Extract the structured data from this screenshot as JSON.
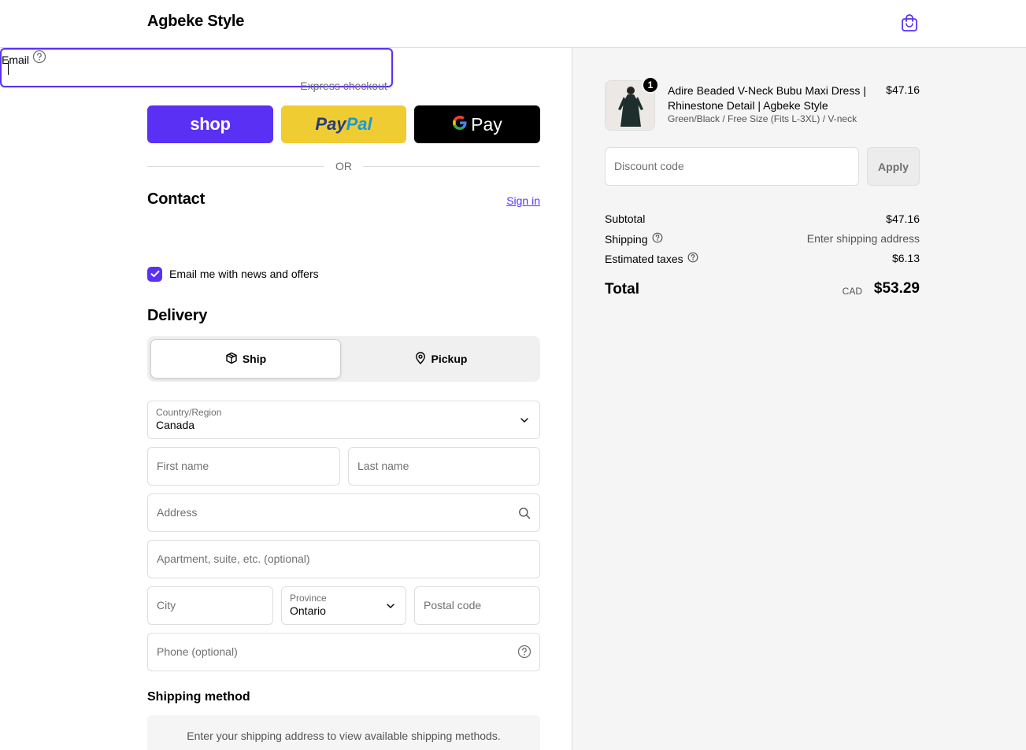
{
  "header": {
    "brand": "Agbeke Style",
    "cart_icon": "shopping-bag-icon"
  },
  "colors": {
    "accent": "#5a31f4",
    "shop_pay": "#5a31f4",
    "paypal": "#f0cc33",
    "gpay": "#000000",
    "summary_bg": "#f5f5f5"
  },
  "express": {
    "label": "Express checkout",
    "shop_label": "shop",
    "paypal_label_1": "Pay",
    "paypal_label_2": "Pal",
    "gpay_label": "Pay",
    "or_label": "OR"
  },
  "contact": {
    "title": "Contact",
    "signin_label": "Sign in",
    "email_placeholder": "Email",
    "newsletter_label": "Email me with news and offers",
    "newsletter_checked": true
  },
  "delivery": {
    "title": "Delivery",
    "ship_label": "Ship",
    "pickup_label": "Pickup",
    "selected": "Ship",
    "country_label": "Country/Region",
    "country_value": "Canada",
    "first_name_placeholder": "First name",
    "last_name_placeholder": "Last name",
    "address_placeholder": "Address",
    "apartment_placeholder": "Apartment, suite, etc. (optional)",
    "city_placeholder": "City",
    "province_label": "Province",
    "province_value": "Ontario",
    "postal_placeholder": "Postal code",
    "phone_placeholder": "Phone (optional)"
  },
  "shipping_method": {
    "title": "Shipping method",
    "message": "Enter your shipping address to view available shipping methods."
  },
  "summary": {
    "product": {
      "quantity": "1",
      "name": "Adire Beaded V-Neck Bubu Maxi Dress | Rhinestone Detail | Agbeke Style",
      "variant": "Green/Black / Free Size (Fits L-3XL) / V-neck",
      "price": "$47.16"
    },
    "discount_placeholder": "Discount code",
    "apply_label": "Apply",
    "subtotal_label": "Subtotal",
    "subtotal_value": "$47.16",
    "shipping_label": "Shipping",
    "shipping_value": "Enter shipping address",
    "taxes_label": "Estimated taxes",
    "taxes_value": "$6.13",
    "total_label": "Total",
    "total_currency": "CAD",
    "total_value": "$53.29"
  }
}
